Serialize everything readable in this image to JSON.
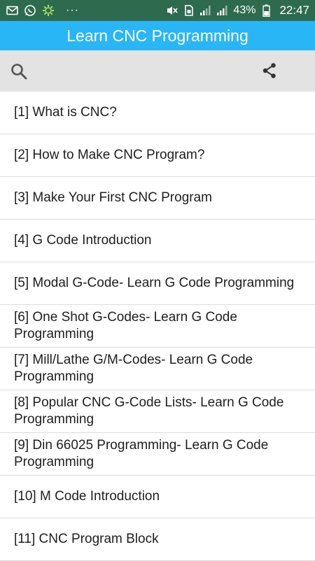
{
  "status_bar": {
    "battery_percent": "43%",
    "time": "22:47",
    "more_dots": "···",
    "background_color": "#2e6b4e"
  },
  "app_bar": {
    "title": "Learn CNC Programming",
    "background_color": "#29b6f6"
  },
  "toolbar": {
    "search_icon": "search-icon",
    "share_icon": "share-icon"
  },
  "list": {
    "items": [
      {
        "label": "[1] What is CNC?"
      },
      {
        "label": "[2] How to Make CNC Program?"
      },
      {
        "label": "[3] Make Your First CNC Program"
      },
      {
        "label": "[4] G Code Introduction"
      },
      {
        "label": "[5] Modal G-Code- Learn G Code Programming"
      },
      {
        "label": "[6] One Shot G-Codes- Learn G Code Programming"
      },
      {
        "label": "[7] Mill/Lathe G/M-Codes- Learn G Code Programming"
      },
      {
        "label": "[8] Popular CNC G-Code Lists- Learn G Code Programming"
      },
      {
        "label": "[9] Din 66025 Programming- Learn G Code Programming"
      },
      {
        "label": "[10] M Code Introduction"
      },
      {
        "label": "[11] CNC Program Block"
      }
    ]
  }
}
